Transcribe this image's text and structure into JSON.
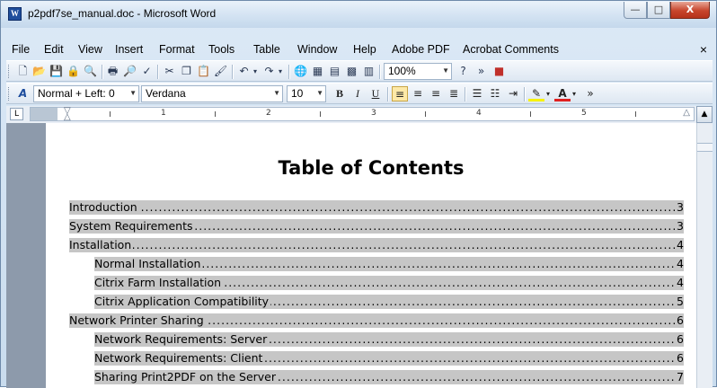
{
  "window": {
    "title": "p2pdf7se_manual.doc - Microsoft Word",
    "app_icon_letter": "W",
    "minimize_glyph": "—",
    "maximize_glyph": "□",
    "close_glyph": "X"
  },
  "menu": {
    "items": [
      "File",
      "Edit",
      "View",
      "Insert",
      "Format",
      "Tools",
      "Table",
      "Window",
      "Help",
      "Adobe PDF",
      "Acrobat Comments"
    ],
    "close_glyph": "×"
  },
  "toolbar_standard": {
    "zoom": "100%",
    "icons": [
      "new-icon",
      "open-icon",
      "save-icon",
      "permission-icon",
      "research-icon",
      "print-icon",
      "print-preview-icon",
      "spelling-icon",
      "cut-icon",
      "copy-icon",
      "paste-icon",
      "format-painter-icon",
      "undo-icon",
      "redo-icon",
      "hyperlink-icon",
      "tables-borders-icon",
      "insert-table-icon",
      "insert-excel-icon",
      "columns-icon",
      "help-icon",
      "more-icon",
      "red-tool-icon"
    ]
  },
  "toolbar_formatting": {
    "style": "Normal + Left: 0",
    "font": "Verdana",
    "size": "10",
    "bold": "B",
    "italic": "I",
    "underline": "U",
    "highlight_color": "#f7f200",
    "font_color": "#e02020"
  },
  "ruler": {
    "numbers": [
      "1",
      "2",
      "3",
      "4",
      "5"
    ]
  },
  "document": {
    "heading": "Table of Contents",
    "toc": [
      {
        "text": "Introduction",
        "page": "3",
        "level": 1
      },
      {
        "text": "System Requirements",
        "page": "3",
        "level": 1
      },
      {
        "text": "Installation",
        "page": "4",
        "level": 1
      },
      {
        "text": "Normal Installation",
        "page": "4",
        "level": 2
      },
      {
        "text": "Citrix Farm Installation",
        "page": "4",
        "level": 2
      },
      {
        "text": "Citrix Application Compatibility",
        "page": "5",
        "level": 2
      },
      {
        "text": "Network Printer Sharing",
        "page": "6",
        "level": 1
      },
      {
        "text": "Network Requirements: Server",
        "page": "6",
        "level": 2
      },
      {
        "text": "Network Requirements: Client",
        "page": "6",
        "level": 2
      },
      {
        "text": "Sharing Print2PDF on the Server",
        "page": "7",
        "level": 2
      }
    ]
  }
}
